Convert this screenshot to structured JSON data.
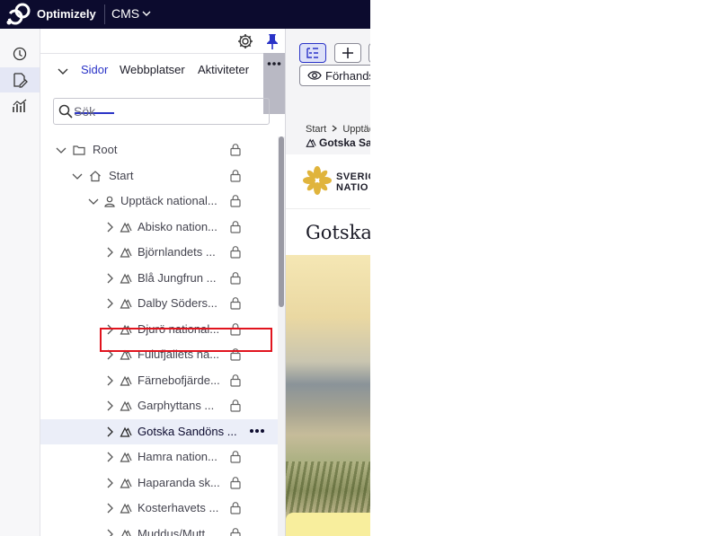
{
  "topbar": {
    "brand": "Optimizely",
    "product": "CMS"
  },
  "rail": {
    "items": [
      {
        "icon": "history-icon"
      },
      {
        "icon": "edit-icon",
        "active": true
      },
      {
        "icon": "analytics-icon"
      }
    ]
  },
  "nav": {
    "tabs": [
      {
        "label": "Sidor",
        "active": true
      },
      {
        "label": "Webbplatser"
      },
      {
        "label": "Aktiviteter"
      }
    ],
    "search": {
      "placeholder": "Sök"
    },
    "tree": [
      {
        "label": "Root",
        "level": 0,
        "icon": "folder-icon",
        "lock": true
      },
      {
        "label": "Start",
        "level": 1,
        "icon": "home-icon",
        "lock": true
      },
      {
        "label": "Upptäck national...",
        "level": 2,
        "icon": "user-page-icon",
        "lock": true
      },
      {
        "label": "Abisko nation...",
        "level": 3,
        "icon": "tree-icon",
        "lock": true
      },
      {
        "label": "Björnlandets ...",
        "level": 3,
        "icon": "tree-icon",
        "lock": true
      },
      {
        "label": "Blå Jungfrun ...",
        "level": 3,
        "icon": "tree-icon",
        "lock": true
      },
      {
        "label": "Dalby Söders...",
        "level": 3,
        "icon": "tree-icon",
        "lock": true
      },
      {
        "label": "Djurö national...",
        "level": 3,
        "icon": "tree-icon",
        "lock": true
      },
      {
        "label": "Fulufjällets na...",
        "level": 3,
        "icon": "tree-icon",
        "lock": true
      },
      {
        "label": "Färnebofjärde...",
        "level": 3,
        "icon": "tree-icon",
        "lock": true
      },
      {
        "label": "Garphyttans ...",
        "level": 3,
        "icon": "tree-icon",
        "lock": true
      },
      {
        "label": "Gotska Sandöns ...",
        "level": 3,
        "icon": "tree-icon",
        "selected": true
      },
      {
        "label": "Hamra nation...",
        "level": 3,
        "icon": "tree-icon",
        "lock": true
      },
      {
        "label": "Haparanda sk...",
        "level": 3,
        "icon": "tree-icon",
        "lock": true
      },
      {
        "label": "Kosterhavets ...",
        "level": 3,
        "icon": "tree-icon",
        "lock": true
      },
      {
        "label": "Muddus/Mutt...",
        "level": 3,
        "icon": "tree-icon",
        "lock": true
      }
    ]
  },
  "preview": {
    "preview_button": "Förhands",
    "breadcrumb": {
      "start": "Start",
      "next": "Upptäc"
    },
    "page_title_short": "Gotska Sa",
    "site_logo_line1": "SVERIG",
    "site_logo_line2": "NATIO",
    "site_title": "Gotska S"
  },
  "colors": {
    "topbar": "#0c0b2e",
    "accent": "#2a33c7",
    "selection_outline": "#e1141e",
    "pin": "#2a33c7",
    "logo_gold": "#e0b43c"
  }
}
